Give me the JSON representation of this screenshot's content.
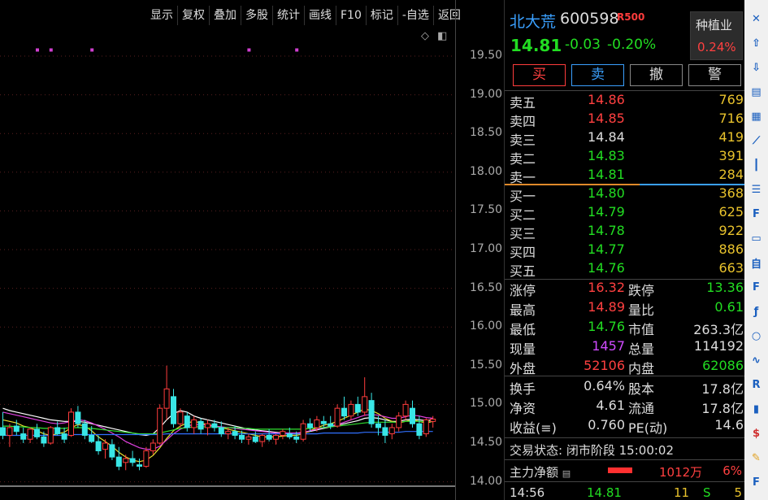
{
  "toolbar": {
    "items": [
      "显示",
      "复权",
      "叠加",
      "多股",
      "统计",
      "画线",
      "F10",
      "标记",
      "-自选",
      "返回"
    ]
  },
  "price_axis": {
    "ticks": [
      "19.50",
      "19.00",
      "18.50",
      "18.00",
      "17.50",
      "17.00",
      "16.50",
      "16.00",
      "15.50",
      "15.00",
      "14.50",
      "14.00"
    ]
  },
  "chart_data": {
    "type": "candlestick",
    "ylim": [
      14.0,
      19.8
    ],
    "candles": [
      [
        14.7,
        14.9,
        14.55,
        14.6
      ],
      [
        14.6,
        14.75,
        14.45,
        14.7
      ],
      [
        14.72,
        14.8,
        14.6,
        14.65
      ],
      [
        14.62,
        14.7,
        14.5,
        14.55
      ],
      [
        14.55,
        14.7,
        14.5,
        14.68
      ],
      [
        14.68,
        14.75,
        14.55,
        14.58
      ],
      [
        14.58,
        14.65,
        14.45,
        14.5
      ],
      [
        14.5,
        14.72,
        14.48,
        14.7
      ],
      [
        14.7,
        14.78,
        14.6,
        14.62
      ],
      [
        14.62,
        14.7,
        14.5,
        14.55
      ],
      [
        14.6,
        14.95,
        14.58,
        14.9
      ],
      [
        14.9,
        14.98,
        14.7,
        14.75
      ],
      [
        14.75,
        14.8,
        14.55,
        14.6
      ],
      [
        14.6,
        14.72,
        14.5,
        14.52
      ],
      [
        14.52,
        14.6,
        14.35,
        14.4
      ],
      [
        14.42,
        14.55,
        14.3,
        14.5
      ],
      [
        14.48,
        14.55,
        14.28,
        14.32
      ],
      [
        14.32,
        14.45,
        14.15,
        14.2
      ],
      [
        14.25,
        14.35,
        14.15,
        14.3
      ],
      [
        14.3,
        14.4,
        14.2,
        14.25
      ],
      [
        14.22,
        14.3,
        14.15,
        14.2
      ],
      [
        14.2,
        14.45,
        14.18,
        14.4
      ],
      [
        14.4,
        14.55,
        14.35,
        14.5
      ],
      [
        14.5,
        15.0,
        14.48,
        14.95
      ],
      [
        14.95,
        15.5,
        14.8,
        15.2
      ],
      [
        15.1,
        15.2,
        14.7,
        14.75
      ],
      [
        14.75,
        14.95,
        14.7,
        14.9
      ],
      [
        14.85,
        14.9,
        14.65,
        14.7
      ],
      [
        14.7,
        14.85,
        14.62,
        14.8
      ],
      [
        14.78,
        14.82,
        14.62,
        14.68
      ],
      [
        14.7,
        14.8,
        14.6,
        14.75
      ],
      [
        14.75,
        14.8,
        14.65,
        14.7
      ],
      [
        14.7,
        14.78,
        14.58,
        14.62
      ],
      [
        14.62,
        14.7,
        14.55,
        14.65
      ],
      [
        14.65,
        14.72,
        14.55,
        14.6
      ],
      [
        14.6,
        14.66,
        14.5,
        14.55
      ],
      [
        14.55,
        14.62,
        14.48,
        14.58
      ],
      [
        14.58,
        14.65,
        14.5,
        14.52
      ],
      [
        14.52,
        14.62,
        14.45,
        14.6
      ],
      [
        14.6,
        14.68,
        14.52,
        14.55
      ],
      [
        14.55,
        14.62,
        14.48,
        14.6
      ],
      [
        14.6,
        14.68,
        14.55,
        14.65
      ],
      [
        14.62,
        14.7,
        14.55,
        14.58
      ],
      [
        14.58,
        14.65,
        14.5,
        14.55
      ],
      [
        14.55,
        14.8,
        14.52,
        14.75
      ],
      [
        14.75,
        14.82,
        14.65,
        14.7
      ],
      [
        14.7,
        14.85,
        14.65,
        14.8
      ],
      [
        14.78,
        14.85,
        14.7,
        14.75
      ],
      [
        14.75,
        14.85,
        14.68,
        14.72
      ],
      [
        14.72,
        15.0,
        14.7,
        14.95
      ],
      [
        14.95,
        15.1,
        14.8,
        14.85
      ],
      [
        14.85,
        15.05,
        14.8,
        15.0
      ],
      [
        15.0,
        15.1,
        14.85,
        14.9
      ],
      [
        14.9,
        15.35,
        14.85,
        15.1
      ],
      [
        15.05,
        15.15,
        14.7,
        14.75
      ],
      [
        14.75,
        14.85,
        14.6,
        14.7
      ],
      [
        14.7,
        14.8,
        14.5,
        14.6
      ],
      [
        14.62,
        14.75,
        14.55,
        14.7
      ],
      [
        14.7,
        14.9,
        14.65,
        14.85
      ],
      [
        14.85,
        15.05,
        14.8,
        15.0
      ],
      [
        14.95,
        15.05,
        14.7,
        14.75
      ],
      [
        14.75,
        14.85,
        14.55,
        14.6
      ],
      [
        14.62,
        14.82,
        14.58,
        14.8
      ],
      [
        14.78,
        14.85,
        14.7,
        14.81
      ]
    ],
    "ma_lines": [
      {
        "color": "#ffffff",
        "values": [
          14.95,
          14.92,
          14.9,
          14.88,
          14.86,
          14.84,
          14.82,
          14.8,
          14.79,
          14.78,
          14.78,
          14.78,
          14.77,
          14.75,
          14.73,
          14.71,
          14.69,
          14.67,
          14.65,
          14.63,
          14.61,
          14.6,
          14.62,
          14.7,
          14.8,
          14.88,
          14.92,
          14.9,
          14.85,
          14.82,
          14.8,
          14.78,
          14.76,
          14.74,
          14.72,
          14.7,
          14.68,
          14.67,
          14.66,
          14.65,
          14.64,
          14.63,
          14.62,
          14.62,
          14.63,
          14.65,
          14.67,
          14.69,
          14.71,
          14.73,
          14.75,
          14.77,
          14.79,
          14.82,
          14.83,
          14.82,
          14.8,
          14.78,
          14.78,
          14.8,
          14.81,
          14.8,
          14.79,
          14.8
        ]
      },
      {
        "color": "#e8e030",
        "values": [
          14.8,
          14.78,
          14.76,
          14.72,
          14.7,
          14.66,
          14.62,
          14.6,
          14.62,
          14.64,
          14.7,
          14.74,
          14.72,
          14.66,
          14.58,
          14.52,
          14.46,
          14.38,
          14.32,
          14.28,
          14.26,
          14.28,
          14.34,
          14.44,
          14.56,
          14.66,
          14.72,
          14.76,
          14.78,
          14.76,
          14.74,
          14.72,
          14.7,
          14.68,
          14.66,
          14.64,
          14.62,
          14.6,
          14.58,
          14.58,
          14.58,
          14.59,
          14.6,
          14.6,
          14.62,
          14.66,
          14.7,
          14.73,
          14.75,
          14.78,
          14.82,
          14.86,
          14.9,
          14.94,
          14.92,
          14.88,
          14.82,
          14.78,
          14.76,
          14.78,
          14.8,
          14.78,
          14.76,
          14.78
        ]
      },
      {
        "color": "#e040e0",
        "values": [
          14.9,
          14.88,
          14.86,
          14.84,
          14.82,
          14.8,
          14.78,
          14.76,
          14.75,
          14.76,
          14.78,
          14.8,
          14.79,
          14.76,
          14.72,
          14.68,
          14.63,
          14.58,
          14.52,
          14.48,
          14.44,
          14.42,
          14.42,
          14.46,
          14.54,
          14.62,
          14.68,
          14.72,
          14.74,
          14.74,
          14.73,
          14.72,
          14.71,
          14.7,
          14.69,
          14.68,
          14.67,
          14.66,
          14.65,
          14.64,
          14.63,
          14.63,
          14.63,
          14.63,
          14.64,
          14.66,
          14.68,
          14.7,
          14.72,
          14.74,
          14.77,
          14.8,
          14.83,
          14.86,
          14.87,
          14.86,
          14.84,
          14.82,
          14.82,
          14.84,
          14.86,
          14.85,
          14.83,
          14.82
        ]
      },
      {
        "color": "#30e030",
        "values": [
          14.72,
          14.72,
          14.71,
          14.71,
          14.7,
          14.7,
          14.69,
          14.69,
          14.69,
          14.69,
          14.7,
          14.7,
          14.7,
          14.69,
          14.68,
          14.67,
          14.66,
          14.65,
          14.64,
          14.63,
          14.62,
          14.62,
          14.62,
          14.63,
          14.65,
          14.67,
          14.69,
          14.7,
          14.71,
          14.71,
          14.71,
          14.71,
          14.7,
          14.7,
          14.7,
          14.69,
          14.69,
          14.68,
          14.68,
          14.68,
          14.68,
          14.68,
          14.68,
          14.68,
          14.68,
          14.69,
          14.7,
          14.7,
          14.71,
          14.72,
          14.73,
          14.74,
          14.75,
          14.76,
          14.77,
          14.77,
          14.77,
          14.77,
          14.77,
          14.78,
          14.78,
          14.78,
          14.78,
          14.78
        ]
      },
      {
        "color": "#3070ff",
        "values": [
          14.6,
          14.6,
          14.6,
          14.6,
          14.6,
          14.6,
          14.6,
          14.6,
          14.6,
          14.6,
          14.61,
          14.61,
          14.61,
          14.61,
          14.61,
          14.61,
          14.61,
          14.61,
          14.61,
          14.61,
          14.61,
          14.61,
          14.61,
          14.61,
          14.62,
          14.62,
          14.62,
          14.62,
          14.62,
          14.62,
          14.62,
          14.62,
          14.62,
          14.62,
          14.62,
          14.62,
          14.62,
          14.62,
          14.62,
          14.62,
          14.62,
          14.62,
          14.62,
          14.62,
          14.62,
          14.62,
          14.62,
          14.63,
          14.63,
          14.63,
          14.63,
          14.63,
          14.63,
          14.64,
          14.64,
          14.64,
          14.64,
          14.64,
          14.64,
          14.65,
          14.65,
          14.65,
          14.65,
          14.65
        ]
      }
    ],
    "markers_price": 19.6,
    "markers_index": [
      5,
      7,
      13,
      36,
      43
    ]
  },
  "quote": {
    "name": "北大荒",
    "code": "600598",
    "badge": "R500",
    "price": "14.81",
    "change": "-0.03",
    "change_pct": "-0.20%",
    "sector_name": "种植业",
    "sector_pct": "0.24%"
  },
  "trade": {
    "buy": "买",
    "sell": "卖",
    "cancel": "撤",
    "alert": "警"
  },
  "order_book": {
    "asks": [
      {
        "label": "卖五",
        "price": "14.86",
        "vol": "769",
        "color": "red"
      },
      {
        "label": "卖四",
        "price": "14.85",
        "vol": "716",
        "color": "red"
      },
      {
        "label": "卖三",
        "price": "14.84",
        "vol": "419",
        "color": "white"
      },
      {
        "label": "卖二",
        "price": "14.83",
        "vol": "391",
        "color": "green"
      },
      {
        "label": "卖一",
        "price": "14.81",
        "vol": "284",
        "color": "green"
      }
    ],
    "bids": [
      {
        "label": "买一",
        "price": "14.80",
        "vol": "368",
        "color": "green"
      },
      {
        "label": "买二",
        "price": "14.79",
        "vol": "625",
        "color": "green"
      },
      {
        "label": "买三",
        "price": "14.78",
        "vol": "922",
        "color": "green"
      },
      {
        "label": "买四",
        "price": "14.77",
        "vol": "886",
        "color": "green"
      },
      {
        "label": "买五",
        "price": "14.76",
        "vol": "663",
        "color": "green"
      }
    ]
  },
  "stats_left": [
    {
      "k": "涨停",
      "v": "16.32",
      "color": "red"
    },
    {
      "k": "最高",
      "v": "14.89",
      "color": "red"
    },
    {
      "k": "最低",
      "v": "14.76",
      "color": "green"
    },
    {
      "k": "现量",
      "v": "1457",
      "color": "purple"
    },
    {
      "k": "外盘",
      "v": "52106",
      "color": "red"
    }
  ],
  "stats_right": [
    {
      "k": "跌停",
      "v": "13.36",
      "color": "green"
    },
    {
      "k": "量比",
      "v": "0.61",
      "color": "green"
    },
    {
      "k": "市值",
      "v": "263.3亿",
      "color": "white"
    },
    {
      "k": "总量",
      "v": "114192",
      "color": "white"
    },
    {
      "k": "内盘",
      "v": "62086",
      "color": "green"
    }
  ],
  "stats2_left": [
    {
      "k": "换手",
      "v": "0.64%",
      "color": "white"
    },
    {
      "k": "净资",
      "v": "4.61",
      "color": "white"
    },
    {
      "k": "收益(≡)",
      "v": "0.760",
      "color": "white"
    }
  ],
  "stats2_right": [
    {
      "k": "股本",
      "v": "17.8亿",
      "color": "white"
    },
    {
      "k": "流通",
      "v": "17.8亿",
      "color": "white"
    },
    {
      "k": "PE(动)",
      "v": "14.6",
      "color": "white"
    }
  ],
  "status": {
    "label": "交易状态:",
    "state": "闭市阶段",
    "time": "15:00:02"
  },
  "flow": {
    "label": "主力净额",
    "amount": "1012万",
    "pct": "6%"
  },
  "tick": {
    "time": "14:56",
    "price": "14.81",
    "vol": "11",
    "side": "S",
    "count": "5"
  },
  "strip_icons": [
    "close-icon",
    "arrow-up-icon",
    "arrow-down-icon",
    "fund-flow-icon",
    "grid-icon",
    "line-chart-icon",
    "candle-icon",
    "list-icon",
    "f10-icon",
    "doc-icon",
    "self-icon",
    "f12-icon",
    "fx-icon",
    "circle-icon",
    "wave-icon",
    "rsi-icon",
    "bar-icon",
    "dollar-icon",
    "pencil-icon",
    "f5-icon"
  ]
}
